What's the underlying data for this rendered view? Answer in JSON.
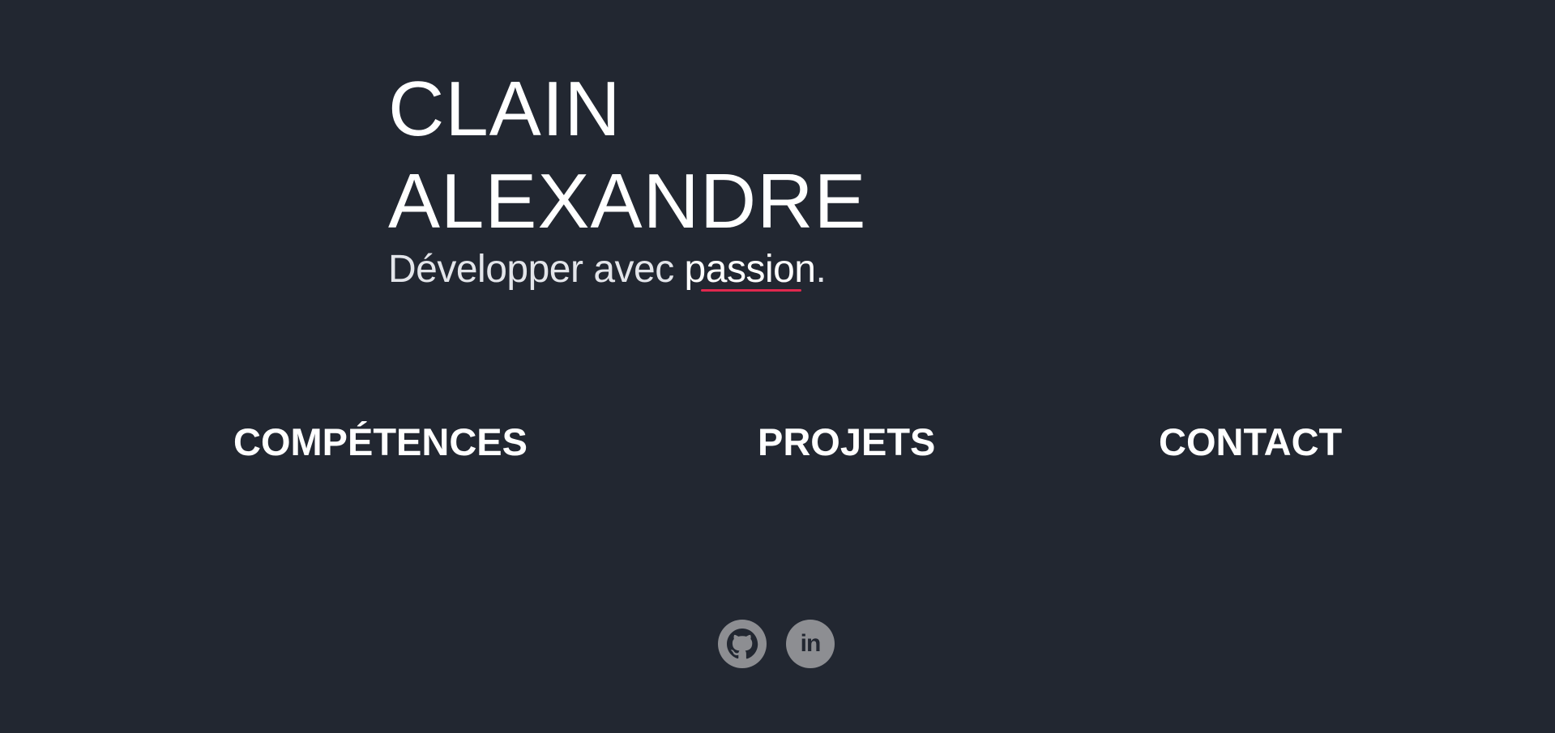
{
  "hero": {
    "name_first": "CLAIN",
    "name_last": "ALEXANDRE",
    "tagline_prefix": "Développer avec ",
    "tagline_highlight": "passion",
    "tagline_suffix": ".",
    "highlight_underline_color": "#e0284e"
  },
  "nav": {
    "items": [
      {
        "label": "COMPÉTENCES"
      },
      {
        "label": "PROJETS"
      },
      {
        "label": "CONTACT"
      }
    ]
  },
  "socials": [
    {
      "icon": "github-icon"
    },
    {
      "icon": "linkedin-icon",
      "glyph": "in"
    }
  ],
  "colors": {
    "background": "#222731",
    "text": "#ffffff",
    "icon_bg": "#8d8e92",
    "accent": "#e0284e"
  }
}
